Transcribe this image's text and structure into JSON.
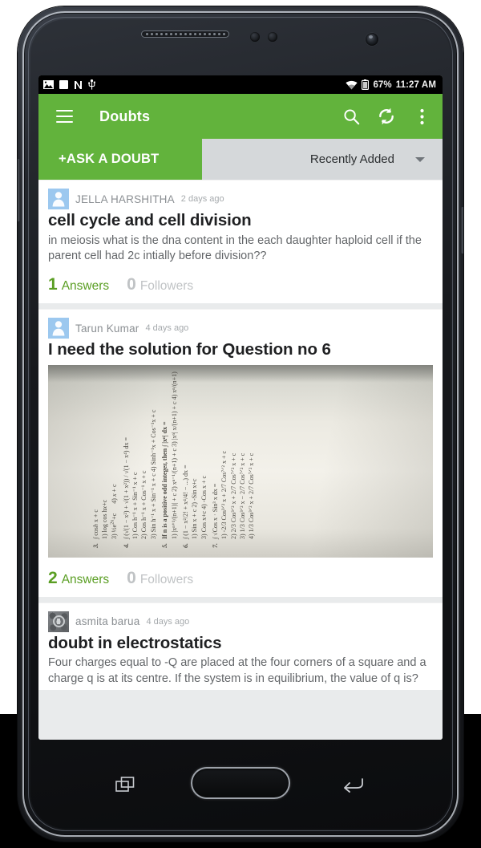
{
  "status_bar": {
    "icons": [
      "image-icon",
      "sdcard-icon",
      "nfc-icon",
      "usb-icon"
    ],
    "wifi_icon": "wifi-icon",
    "battery_icon": "battery-icon",
    "battery_percent": "67%",
    "clock": "11:27 AM"
  },
  "toolbar": {
    "menu_icon": "hamburger-menu-icon",
    "title": "Doubts",
    "search_icon": "search-icon",
    "refresh_icon": "refresh-icon",
    "overflow_icon": "overflow-menu-icon",
    "accent_color": "#62b33c"
  },
  "subbar": {
    "ask_label": "+ASK A DOUBT",
    "sort_value": "Recently Added",
    "sort_caret_icon": "chevron-down-icon",
    "background": "#d5d8da"
  },
  "feed": {
    "cards": [
      {
        "author": "JELLA HARSHITHA",
        "time": "2 days ago",
        "avatar": "person-avatar",
        "title": "cell cycle and cell division",
        "body": "in meiosis what is the dna content in the each daughter haploid cell if the parent cell had 2c intially before division??",
        "answers_count": "1",
        "answers_label": "Answers",
        "followers_count": "0",
        "followers_label": "Followers"
      },
      {
        "author": "Tarun Kumar",
        "time": "4 days ago",
        "avatar": "person-avatar",
        "title": "I need the solution for Question no 6",
        "body": "",
        "attachment": "handwritten-math-page-photo",
        "answers_count": "2",
        "answers_label": "Answers",
        "followers_count": "0",
        "followers_label": "Followers"
      },
      {
        "author": "asmita barua",
        "time": "4 days ago",
        "avatar": "photo-avatar",
        "title": "doubt in electrostatics",
        "body": "Four charges equal to -Q are placed at the four corners of a square and a charge q is at its centre. If the system is in equilibrium, the value of q is?",
        "answers_count": "",
        "answers_label": "",
        "followers_count": "",
        "followers_label": ""
      }
    ]
  },
  "attachment_text": {
    "q3": {
      "n": "3.",
      "lines": [
        "∫ cos h x + c",
        "1) log cos hx+c",
        "3)  ½ e²ˣ + c",
        "4) x + c"
      ]
    },
    "q4": {
      "n": "4.",
      "expr": "∫ (√(1 − x²) + √(1 + x²)) / √(1 − x⁴) dx =",
      "options": [
        "1) Cos h⁻¹ x + Sin⁻¹ x + c",
        "2) Cos h⁻¹ x + Cos⁻¹ x + c",
        "3) Sin h⁻¹ x + Sin⁻¹ x + c",
        "4) Sinh⁻¹x + Cos⁻¹x + c"
      ]
    },
    "q5": {
      "n": "5.",
      "stem": "If n is a positive odd integer, then ∫ |xⁿ| dx =",
      "options": [
        "1) |xⁿ⁺¹/(n+1)| + c",
        "2) xⁿ⁻¹/(n+1) + c",
        "3) |xⁿ| x/(n+1) + c",
        "4) xⁿ/(n+1)"
      ]
    },
    "q6": {
      "n": "6.",
      "stem": "∫ (1 − x²/2! + x⁴/4! − ...) dx =",
      "options": [
        "1) Sin x + c",
        "2) -Sin x+c",
        "3) Cos x+c",
        "4) -Cos x + c"
      ]
    },
    "q7": {
      "n": "7.",
      "stem": "∫ √Cos x · Sin³ x dx =",
      "options": [
        "1) -2/3 Cos³ᐟ² x + 2/7 Cos⁷ᐟ² x + c",
        "2) 2/3 Cos³ᐟ² x + 2/7 Cos⁷ᐟ² x + c",
        "3) 1/3 Cos³ᐟ² x − 2/7 Cos⁷ᐟ² x + c",
        "4) 1/3 Cos³ᐟ² x + 2/7 Cos⁷ᐟ² x + c"
      ]
    }
  },
  "device": {
    "recents_icon": "recent-apps-icon",
    "home_button": "home-button",
    "back_icon": "back-icon",
    "earpiece": "earpiece-speaker",
    "front_camera": "front-camera",
    "volume_button": "volume-rocker",
    "power_button": "power-button"
  }
}
